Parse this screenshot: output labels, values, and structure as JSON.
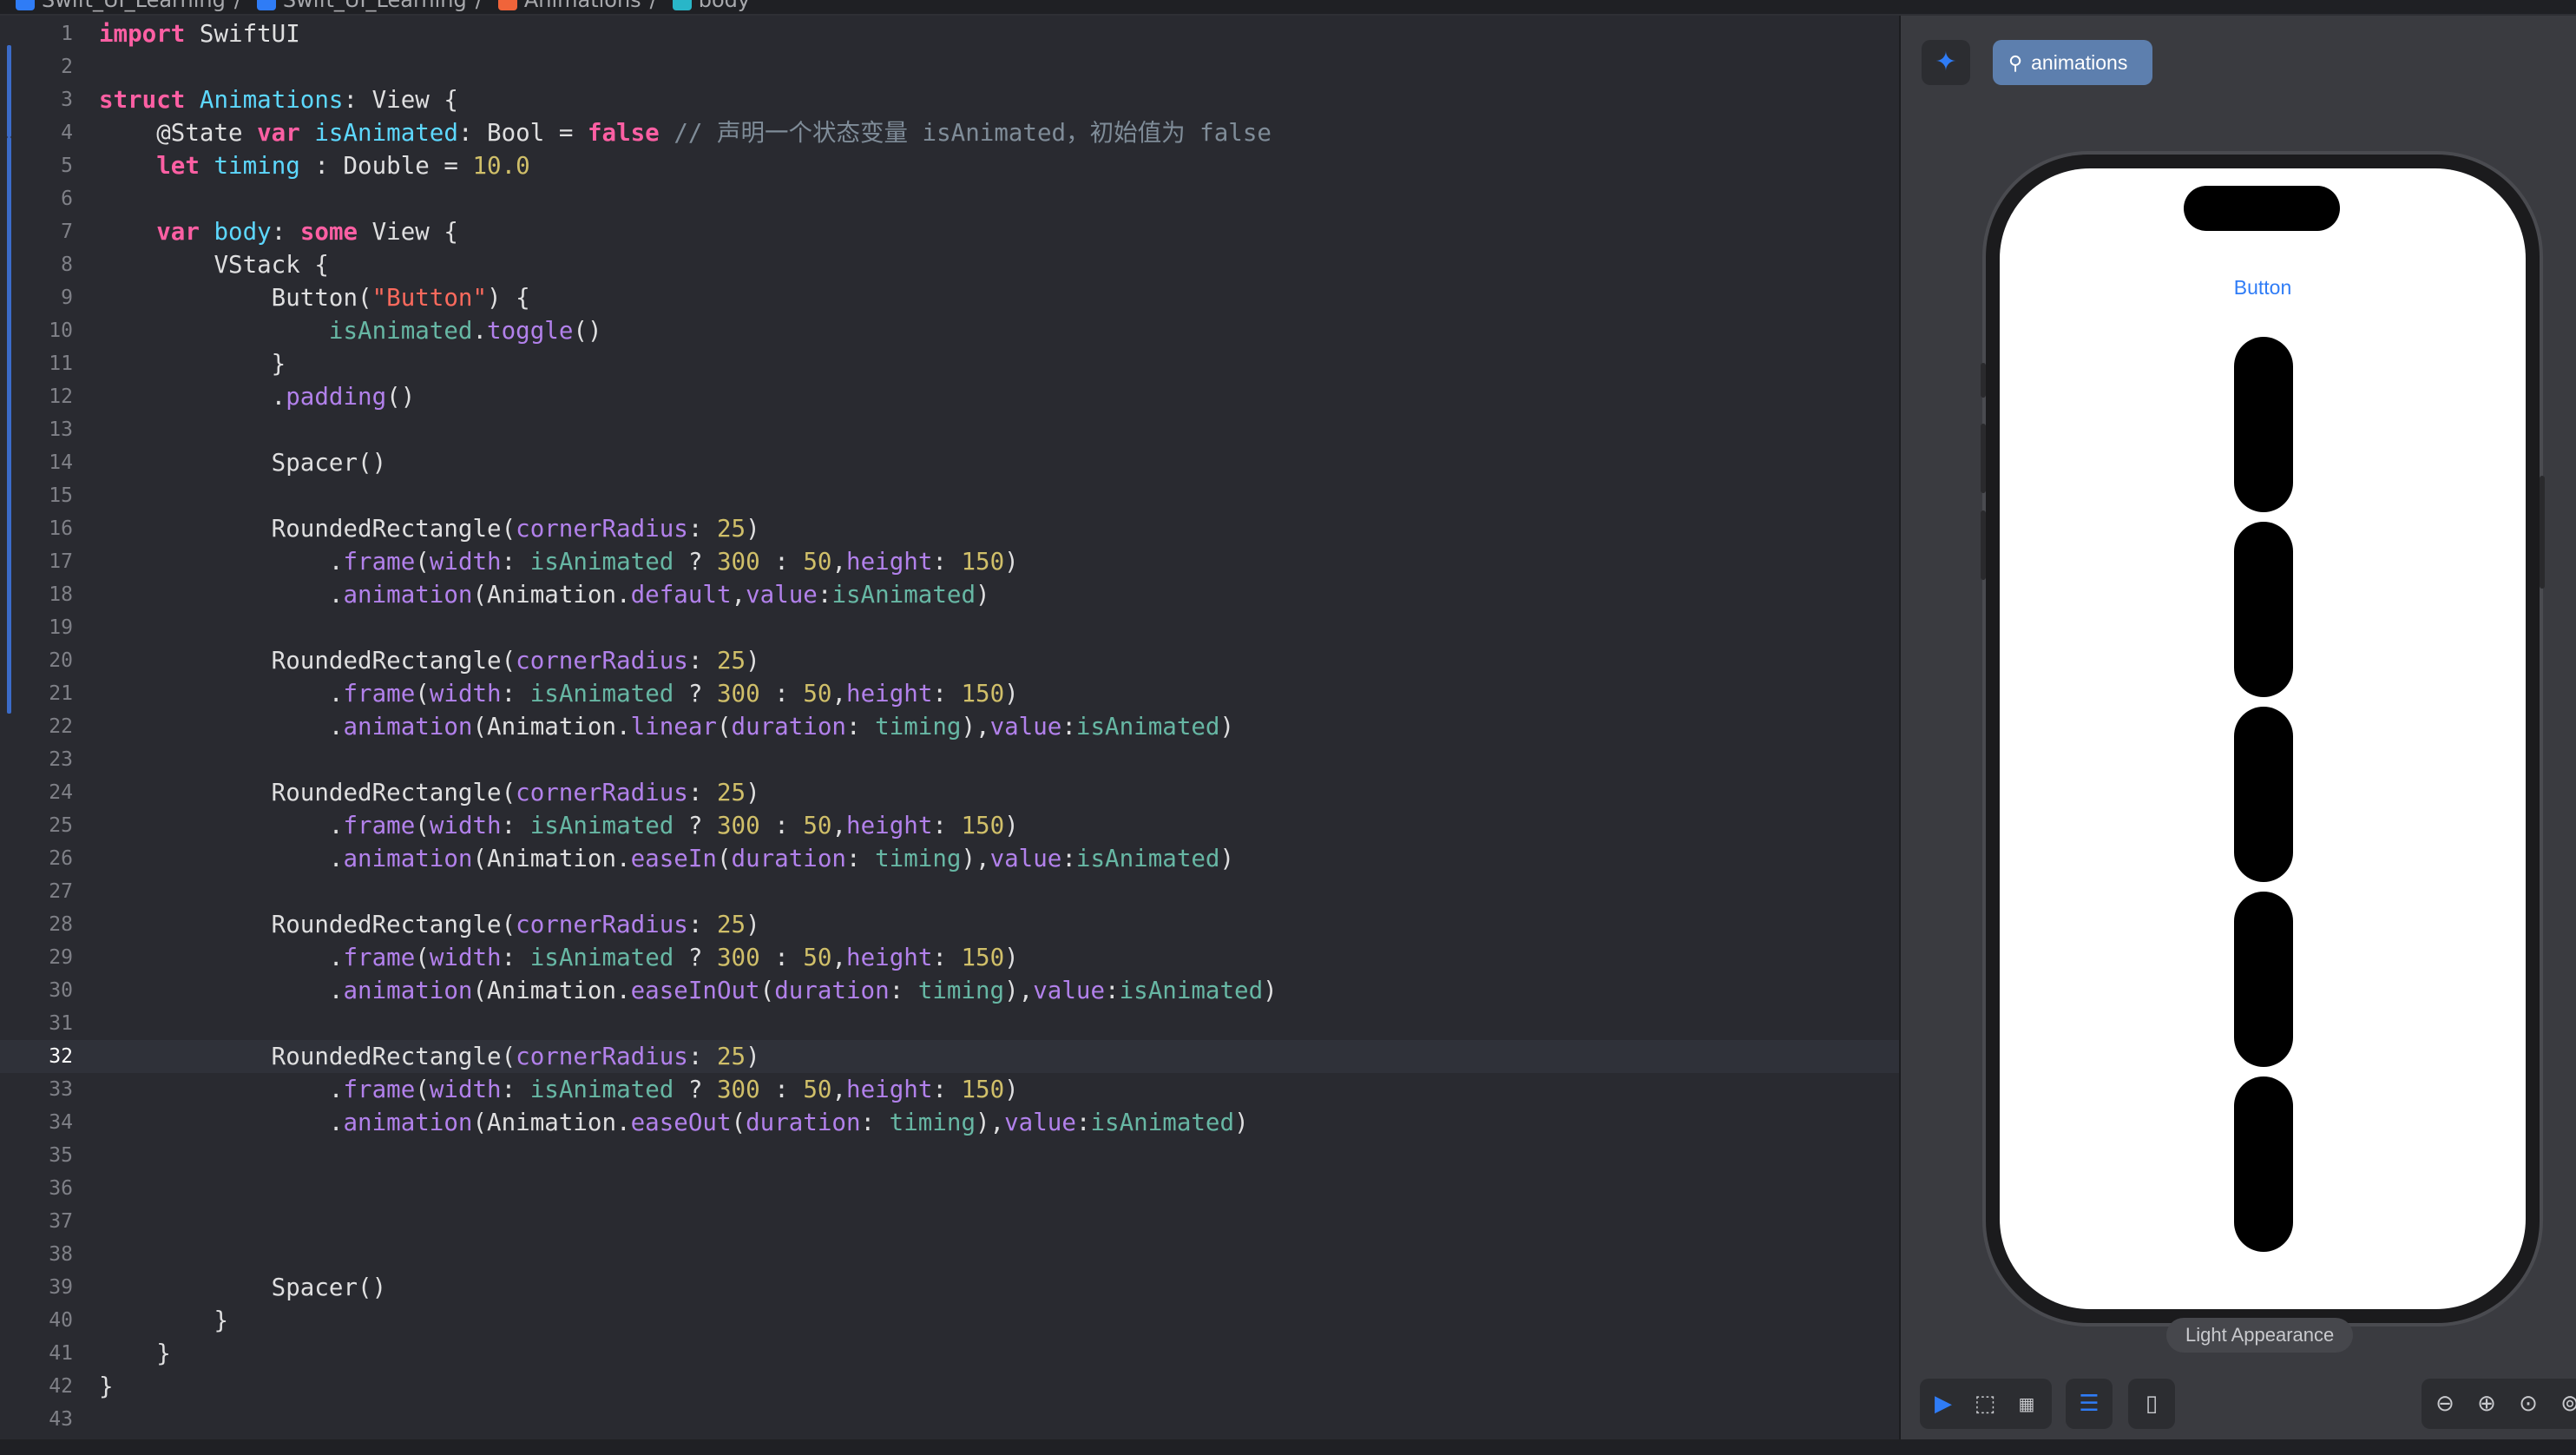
{
  "breadcrumb": [
    "Swift_UI_Learning",
    "Swift_UI_Learning",
    "Animations",
    "body"
  ],
  "editor": {
    "current_line": 32,
    "lines": [
      {
        "n": "1",
        "t": [
          [
            "kw",
            "import"
          ],
          [
            "pl",
            " SwiftUI"
          ]
        ]
      },
      {
        "n": "2",
        "t": []
      },
      {
        "n": "3",
        "t": [
          [
            "kw",
            "struct"
          ],
          [
            "pl",
            " "
          ],
          [
            "ty",
            "Animations"
          ],
          [
            "pl",
            ": View {"
          ]
        ]
      },
      {
        "n": "4",
        "t": [
          [
            "pl",
            "    @State "
          ],
          [
            "kw",
            "var"
          ],
          [
            "pl",
            " "
          ],
          [
            "ty",
            "isAnimated"
          ],
          [
            "pl",
            ": Bool = "
          ],
          [
            "kw",
            "false"
          ],
          [
            "pl",
            " "
          ],
          [
            "cm",
            "// 声明一个状态变量 isAnimated，初始值为 false"
          ]
        ]
      },
      {
        "n": "5",
        "t": [
          [
            "pl",
            "    "
          ],
          [
            "kw",
            "let"
          ],
          [
            "pl",
            " "
          ],
          [
            "ty",
            "timing"
          ],
          [
            "pl",
            " : Double = "
          ],
          [
            "nu",
            "10.0"
          ]
        ]
      },
      {
        "n": "6",
        "t": []
      },
      {
        "n": "7",
        "t": [
          [
            "pl",
            "    "
          ],
          [
            "kw",
            "var"
          ],
          [
            "pl",
            " "
          ],
          [
            "ty",
            "body"
          ],
          [
            "pl",
            ": "
          ],
          [
            "kw",
            "some"
          ],
          [
            "pl",
            " View {"
          ]
        ]
      },
      {
        "n": "8",
        "t": [
          [
            "pl",
            "        VStack {"
          ]
        ]
      },
      {
        "n": "9",
        "t": [
          [
            "pl",
            "            Button("
          ],
          [
            "st",
            "\"Button\""
          ],
          [
            "pl",
            ") {"
          ]
        ]
      },
      {
        "n": "10",
        "t": [
          [
            "pl",
            "                "
          ],
          [
            "pr",
            "isAnimated"
          ],
          [
            "pl",
            "."
          ],
          [
            "fn",
            "toggle"
          ],
          [
            "pl",
            "()"
          ]
        ]
      },
      {
        "n": "11",
        "t": [
          [
            "pl",
            "            }"
          ]
        ]
      },
      {
        "n": "12",
        "t": [
          [
            "pl",
            "            ."
          ],
          [
            "fn",
            "padding"
          ],
          [
            "pl",
            "()"
          ]
        ]
      },
      {
        "n": "13",
        "t": []
      },
      {
        "n": "14",
        "t": [
          [
            "pl",
            "            Spacer()"
          ]
        ]
      },
      {
        "n": "15",
        "t": []
      },
      {
        "n": "16",
        "t": [
          [
            "pl",
            "            RoundedRectangle("
          ],
          [
            "fn",
            "cornerRadius"
          ],
          [
            "pl",
            ": "
          ],
          [
            "nu",
            "25"
          ],
          [
            "pl",
            ")"
          ]
        ]
      },
      {
        "n": "17",
        "t": [
          [
            "pl",
            "                ."
          ],
          [
            "fn",
            "frame"
          ],
          [
            "pl",
            "("
          ],
          [
            "fn",
            "width"
          ],
          [
            "pl",
            ": "
          ],
          [
            "pr",
            "isAnimated"
          ],
          [
            "pl",
            " ? "
          ],
          [
            "nu",
            "300"
          ],
          [
            "pl",
            " : "
          ],
          [
            "nu",
            "50"
          ],
          [
            "pl",
            ","
          ],
          [
            "fn",
            "height"
          ],
          [
            "pl",
            ": "
          ],
          [
            "nu",
            "150"
          ],
          [
            "pl",
            ")"
          ]
        ]
      },
      {
        "n": "18",
        "t": [
          [
            "pl",
            "                ."
          ],
          [
            "fn",
            "animation"
          ],
          [
            "pl",
            "(Animation."
          ],
          [
            "fn",
            "default"
          ],
          [
            "pl",
            ","
          ],
          [
            "fn",
            "value"
          ],
          [
            "pl",
            ":"
          ],
          [
            "pr",
            "isAnimated"
          ],
          [
            "pl",
            ")"
          ]
        ]
      },
      {
        "n": "19",
        "t": []
      },
      {
        "n": "20",
        "t": [
          [
            "pl",
            "            RoundedRectangle("
          ],
          [
            "fn",
            "cornerRadius"
          ],
          [
            "pl",
            ": "
          ],
          [
            "nu",
            "25"
          ],
          [
            "pl",
            ")"
          ]
        ]
      },
      {
        "n": "21",
        "t": [
          [
            "pl",
            "                ."
          ],
          [
            "fn",
            "frame"
          ],
          [
            "pl",
            "("
          ],
          [
            "fn",
            "width"
          ],
          [
            "pl",
            ": "
          ],
          [
            "pr",
            "isAnimated"
          ],
          [
            "pl",
            " ? "
          ],
          [
            "nu",
            "300"
          ],
          [
            "pl",
            " : "
          ],
          [
            "nu",
            "50"
          ],
          [
            "pl",
            ","
          ],
          [
            "fn",
            "height"
          ],
          [
            "pl",
            ": "
          ],
          [
            "nu",
            "150"
          ],
          [
            "pl",
            ")"
          ]
        ]
      },
      {
        "n": "22",
        "t": [
          [
            "pl",
            "                ."
          ],
          [
            "fn",
            "animation"
          ],
          [
            "pl",
            "(Animation."
          ],
          [
            "fn",
            "linear"
          ],
          [
            "pl",
            "("
          ],
          [
            "fn",
            "duration"
          ],
          [
            "pl",
            ": "
          ],
          [
            "pr",
            "timing"
          ],
          [
            "pl",
            "),"
          ],
          [
            "fn",
            "value"
          ],
          [
            "pl",
            ":"
          ],
          [
            "pr",
            "isAnimated"
          ],
          [
            "pl",
            ")"
          ]
        ]
      },
      {
        "n": "23",
        "t": []
      },
      {
        "n": "24",
        "t": [
          [
            "pl",
            "            RoundedRectangle("
          ],
          [
            "fn",
            "cornerRadius"
          ],
          [
            "pl",
            ": "
          ],
          [
            "nu",
            "25"
          ],
          [
            "pl",
            ")"
          ]
        ]
      },
      {
        "n": "25",
        "t": [
          [
            "pl",
            "                ."
          ],
          [
            "fn",
            "frame"
          ],
          [
            "pl",
            "("
          ],
          [
            "fn",
            "width"
          ],
          [
            "pl",
            ": "
          ],
          [
            "pr",
            "isAnimated"
          ],
          [
            "pl",
            " ? "
          ],
          [
            "nu",
            "300"
          ],
          [
            "pl",
            " : "
          ],
          [
            "nu",
            "50"
          ],
          [
            "pl",
            ","
          ],
          [
            "fn",
            "height"
          ],
          [
            "pl",
            ": "
          ],
          [
            "nu",
            "150"
          ],
          [
            "pl",
            ")"
          ]
        ]
      },
      {
        "n": "26",
        "t": [
          [
            "pl",
            "                ."
          ],
          [
            "fn",
            "animation"
          ],
          [
            "pl",
            "(Animation."
          ],
          [
            "fn",
            "easeIn"
          ],
          [
            "pl",
            "("
          ],
          [
            "fn",
            "duration"
          ],
          [
            "pl",
            ": "
          ],
          [
            "pr",
            "timing"
          ],
          [
            "pl",
            "),"
          ],
          [
            "fn",
            "value"
          ],
          [
            "pl",
            ":"
          ],
          [
            "pr",
            "isAnimated"
          ],
          [
            "pl",
            ")"
          ]
        ]
      },
      {
        "n": "27",
        "t": []
      },
      {
        "n": "28",
        "t": [
          [
            "pl",
            "            RoundedRectangle("
          ],
          [
            "fn",
            "cornerRadius"
          ],
          [
            "pl",
            ": "
          ],
          [
            "nu",
            "25"
          ],
          [
            "pl",
            ")"
          ]
        ]
      },
      {
        "n": "29",
        "t": [
          [
            "pl",
            "                ."
          ],
          [
            "fn",
            "frame"
          ],
          [
            "pl",
            "("
          ],
          [
            "fn",
            "width"
          ],
          [
            "pl",
            ": "
          ],
          [
            "pr",
            "isAnimated"
          ],
          [
            "pl",
            " ? "
          ],
          [
            "nu",
            "300"
          ],
          [
            "pl",
            " : "
          ],
          [
            "nu",
            "50"
          ],
          [
            "pl",
            ","
          ],
          [
            "fn",
            "height"
          ],
          [
            "pl",
            ": "
          ],
          [
            "nu",
            "150"
          ],
          [
            "pl",
            ")"
          ]
        ]
      },
      {
        "n": "30",
        "t": [
          [
            "pl",
            "                ."
          ],
          [
            "fn",
            "animation"
          ],
          [
            "pl",
            "(Animation."
          ],
          [
            "fn",
            "easeInOut"
          ],
          [
            "pl",
            "("
          ],
          [
            "fn",
            "duration"
          ],
          [
            "pl",
            ": "
          ],
          [
            "pr",
            "timing"
          ],
          [
            "pl",
            "),"
          ],
          [
            "fn",
            "value"
          ],
          [
            "pl",
            ":"
          ],
          [
            "pr",
            "isAnimated"
          ],
          [
            "pl",
            ")"
          ]
        ]
      },
      {
        "n": "31",
        "t": []
      },
      {
        "n": "32",
        "t": [
          [
            "pl",
            "            RoundedRectangle("
          ],
          [
            "fn",
            "cornerRadius"
          ],
          [
            "pl",
            ": "
          ],
          [
            "nu",
            "25"
          ],
          [
            "pl",
            ")"
          ]
        ]
      },
      {
        "n": "33",
        "t": [
          [
            "pl",
            "                ."
          ],
          [
            "fn",
            "frame"
          ],
          [
            "pl",
            "("
          ],
          [
            "fn",
            "width"
          ],
          [
            "pl",
            ": "
          ],
          [
            "pr",
            "isAnimated"
          ],
          [
            "pl",
            " ? "
          ],
          [
            "nu",
            "300"
          ],
          [
            "pl",
            " : "
          ],
          [
            "nu",
            "50"
          ],
          [
            "pl",
            ","
          ],
          [
            "fn",
            "height"
          ],
          [
            "pl",
            ": "
          ],
          [
            "nu",
            "150"
          ],
          [
            "pl",
            ")"
          ]
        ]
      },
      {
        "n": "34",
        "t": [
          [
            "pl",
            "                ."
          ],
          [
            "fn",
            "animation"
          ],
          [
            "pl",
            "(Animation."
          ],
          [
            "fn",
            "easeOut"
          ],
          [
            "pl",
            "("
          ],
          [
            "fn",
            "duration"
          ],
          [
            "pl",
            ": "
          ],
          [
            "pr",
            "timing"
          ],
          [
            "pl",
            "),"
          ],
          [
            "fn",
            "value"
          ],
          [
            "pl",
            ":"
          ],
          [
            "pr",
            "isAnimated"
          ],
          [
            "pl",
            ")"
          ]
        ]
      },
      {
        "n": "35",
        "t": []
      },
      {
        "n": "36",
        "t": []
      },
      {
        "n": "37",
        "t": []
      },
      {
        "n": "38",
        "t": []
      },
      {
        "n": "39",
        "t": [
          [
            "pl",
            "            Spacer()"
          ]
        ]
      },
      {
        "n": "40",
        "t": [
          [
            "pl",
            "        }"
          ]
        ]
      },
      {
        "n": "41",
        "t": [
          [
            "pl",
            "    }"
          ]
        ]
      },
      {
        "n": "42",
        "t": [
          [
            "pl",
            "}"
          ]
        ]
      },
      {
        "n": "43",
        "t": []
      }
    ]
  },
  "preview": {
    "pin_icon": "pin-icon",
    "tab_label": "animations",
    "button_label": "Button",
    "rectangles": 5,
    "appearance_label": "Light Appearance",
    "colors": {
      "accent": "#2f7cf6",
      "tab_chip": "#5d7fae",
      "screen": "#ffffff",
      "shape": "#000000"
    },
    "toolbar": {
      "mode_icons": [
        "live-preview-icon",
        "selectable-icon",
        "variants-icon"
      ],
      "settings_icon": "canvas-settings-icon",
      "device_icon": "device-icon",
      "zoom_icons": [
        "zoom-out-icon",
        "zoom-in-icon",
        "zoom-actual-icon",
        "zoom-fit-icon"
      ]
    }
  }
}
